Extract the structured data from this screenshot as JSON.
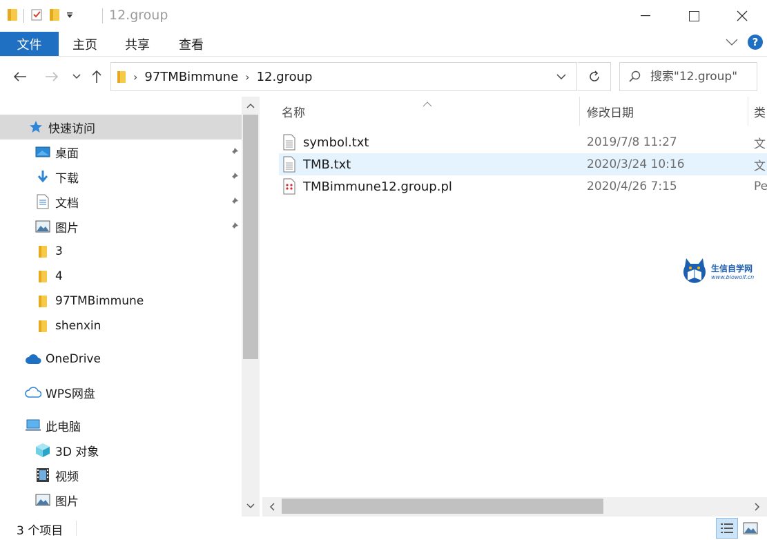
{
  "window": {
    "title": "12.group"
  },
  "ribbon": {
    "tabs": [
      "文件",
      "主页",
      "共享",
      "查看"
    ],
    "help": "?"
  },
  "address": {
    "crumbs": [
      "97TMBimmune",
      "12.group"
    ],
    "search_placeholder": "搜索\"12.group\""
  },
  "nav": {
    "quick_access": "快速访问",
    "items": [
      {
        "label": "桌面",
        "icon": "desktop-icon",
        "pinned": true
      },
      {
        "label": "下载",
        "icon": "download-icon",
        "pinned": true
      },
      {
        "label": "文档",
        "icon": "document-icon",
        "pinned": true
      },
      {
        "label": "图片",
        "icon": "picture-icon",
        "pinned": true
      },
      {
        "label": "3",
        "icon": "folder-icon",
        "pinned": false
      },
      {
        "label": "4",
        "icon": "folder-icon",
        "pinned": false
      },
      {
        "label": "97TMBimmune",
        "icon": "folder-icon",
        "pinned": false
      },
      {
        "label": "shenxin",
        "icon": "folder-icon",
        "pinned": false
      }
    ],
    "onedrive": "OneDrive",
    "wps": "WPS网盘",
    "this_pc": "此电脑",
    "pc_items": [
      {
        "label": "3D 对象",
        "icon": "3d-objects-icon"
      },
      {
        "label": "视频",
        "icon": "video-icon"
      },
      {
        "label": "图片",
        "icon": "picture-icon"
      }
    ]
  },
  "files": {
    "columns": [
      "名称",
      "修改日期",
      "类"
    ],
    "rows": [
      {
        "name": "symbol.txt",
        "date": "2019/7/8 11:27",
        "type": "文",
        "icon": "text-file-icon"
      },
      {
        "name": "TMB.txt",
        "date": "2020/3/24 10:16",
        "type": "文",
        "icon": "text-file-icon"
      },
      {
        "name": "TMBimmune12.group.pl",
        "date": "2020/4/26 7:15",
        "type": "Pe",
        "icon": "perl-file-icon"
      }
    ]
  },
  "status": {
    "count": "3 个项目"
  },
  "watermark": {
    "name": "生信自学网",
    "url": "www.biowolf.cn"
  }
}
